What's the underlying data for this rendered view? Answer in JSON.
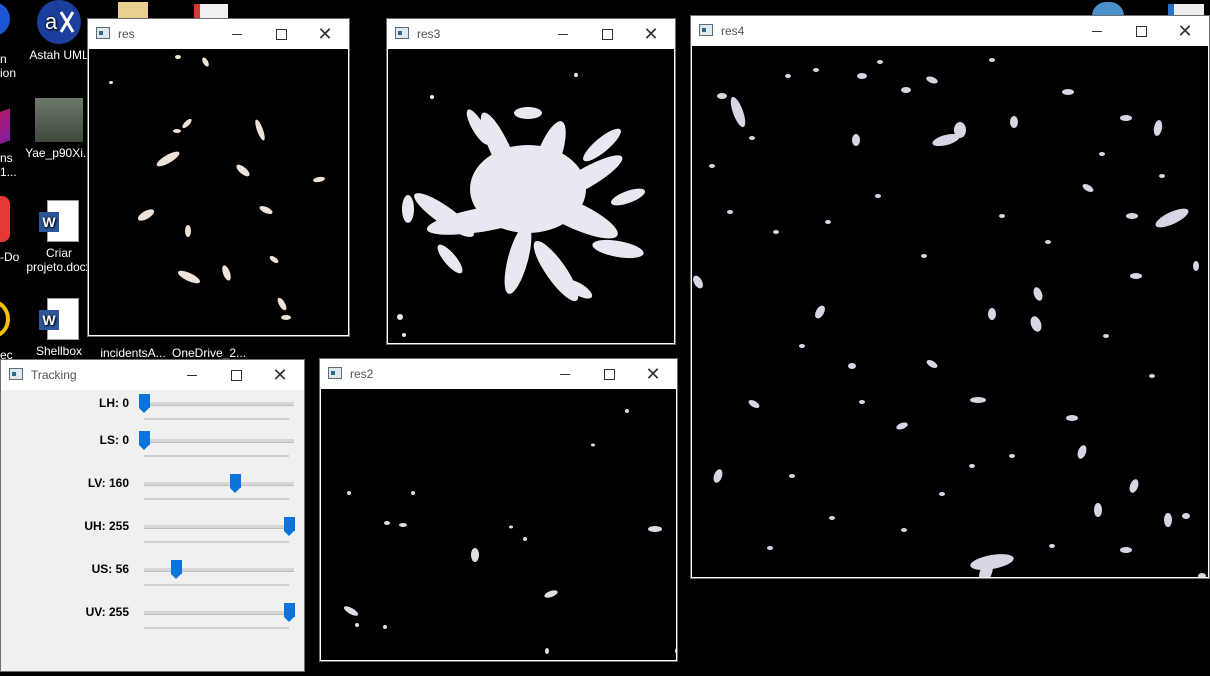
{
  "desktop": {
    "icons": [
      {
        "id": "astah",
        "label": "Astah UML"
      },
      {
        "id": "video",
        "label": "Yae_p90Xi..."
      },
      {
        "id": "word1",
        "label": "Criar projeto.docx"
      },
      {
        "id": "word2",
        "label": "Shellbox"
      },
      {
        "id": "folder1",
        "label": "incidentsA..."
      },
      {
        "id": "folder2",
        "label": "OneDrive_2..."
      }
    ],
    "partials": [
      "n",
      "ion",
      "ns",
      "1...",
      "-Do",
      "ec"
    ]
  },
  "windows": {
    "res": {
      "title": "res"
    },
    "res3": {
      "title": "res3"
    },
    "res4": {
      "title": "res4"
    },
    "res2": {
      "title": "res2"
    },
    "tracking": {
      "title": "Tracking",
      "accent": "#0a74d8",
      "sliders": [
        {
          "label": "LH: 0",
          "value": 0,
          "max": 255
        },
        {
          "label": "LS: 0",
          "value": 0,
          "max": 255
        },
        {
          "label": "LV: 160",
          "value": 160,
          "max": 255
        },
        {
          "label": "UH: 255",
          "value": 255,
          "max": 255
        },
        {
          "label": "US: 56",
          "value": 56,
          "max": 255
        },
        {
          "label": "UV: 255",
          "value": 255,
          "max": 255
        }
      ]
    }
  },
  "icons": {
    "minimize": "minimize-icon",
    "maximize": "maximize-icon",
    "close": "close-icon"
  }
}
